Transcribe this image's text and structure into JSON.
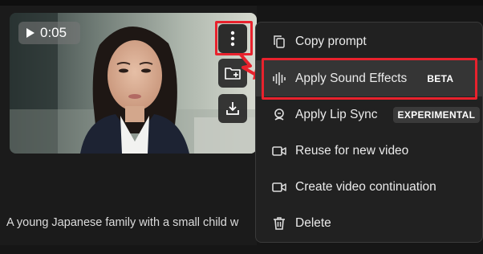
{
  "video": {
    "duration": "0:05",
    "prompt": "A young Japanese family with a small child w"
  },
  "actions": {
    "more_icon": "vertical-dots-icon",
    "save_icon": "folder-add-icon",
    "download_icon": "download-icon"
  },
  "menu": {
    "items": [
      {
        "label": "Copy prompt",
        "icon": "copy-icon"
      },
      {
        "label": "Apply Sound Effects",
        "icon": "sound-wave-icon",
        "badge": "BETA"
      },
      {
        "label": "Apply Lip Sync",
        "icon": "lips-icon",
        "badge": "EXPERIMENTAL"
      },
      {
        "label": "Reuse for new video",
        "icon": "video-camera-icon"
      },
      {
        "label": "Create video continuation",
        "icon": "video-camera-icon"
      },
      {
        "label": "Delete",
        "icon": "trash-icon"
      }
    ]
  },
  "colors": {
    "highlight_outline": "#e8222d",
    "menu_background": "#212121",
    "hover_background": "#353535"
  }
}
